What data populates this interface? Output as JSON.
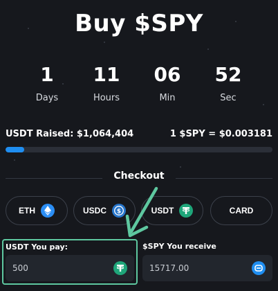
{
  "title": "Buy $SPY",
  "countdown": [
    {
      "value": "1",
      "label": "Days"
    },
    {
      "value": "11",
      "label": "Hours"
    },
    {
      "value": "06",
      "label": "Min"
    },
    {
      "value": "52",
      "label": "Sec"
    }
  ],
  "raised": {
    "label": "USDT Raised: $1,064,404",
    "price": "1 $SPY = $0.003181",
    "progress_fraction": 0.07
  },
  "checkout_label": "Checkout",
  "payment_methods": [
    {
      "label": "ETH",
      "icon": "eth-icon"
    },
    {
      "label": "USDC",
      "icon": "usdc-icon"
    },
    {
      "label": "USDT",
      "icon": "usdt-icon"
    },
    {
      "label": "CARD",
      "icon": ""
    }
  ],
  "pay_field": {
    "label": "USDT You pay:",
    "value": "500",
    "icon": "usdt-icon"
  },
  "receive_field": {
    "label": "$SPY You receive",
    "value": "15717.00",
    "icon": "spy-token-icon"
  },
  "colors": {
    "background": "#16181d",
    "accent_blue": "#1f8ef1",
    "highlight_green": "#5ec8a0",
    "usdt_green": "#1fa67a"
  }
}
